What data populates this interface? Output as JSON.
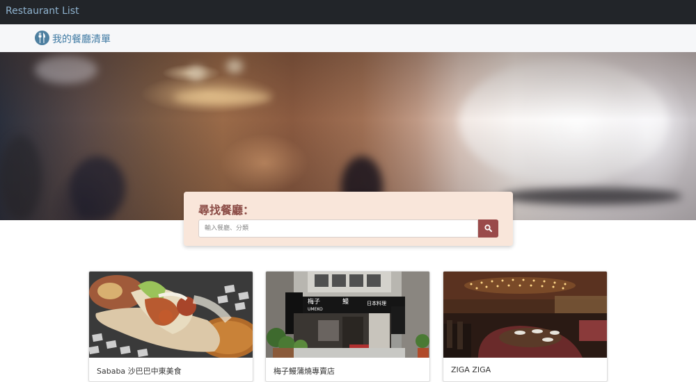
{
  "navbar": {
    "brand": "Restaurant List"
  },
  "header": {
    "title": "我的餐廳清單",
    "logo_icon": "fork-knife-icon"
  },
  "search": {
    "heading": "尋找餐廳：",
    "placeholder": "輸入餐廳、分類",
    "button_icon": "search-icon"
  },
  "restaurants": [
    {
      "name": "Sababa 沙巴巴中東美食"
    },
    {
      "name": "梅子鰻蒲燒專賣店",
      "sign_main": "梅子",
      "sign_eel": "鰻",
      "sign_jp": "日本料理",
      "sign_brand": "UMEKO"
    },
    {
      "name": "ZIGA ZIGA"
    }
  ],
  "colors": {
    "navbar_bg": "#222529",
    "brand_text": "#8fb3cf",
    "header_title": "#3f7aa3",
    "search_card_bg": "#f9e6da",
    "search_heading": "#8a4a44",
    "search_button": "#9a4a4a"
  }
}
